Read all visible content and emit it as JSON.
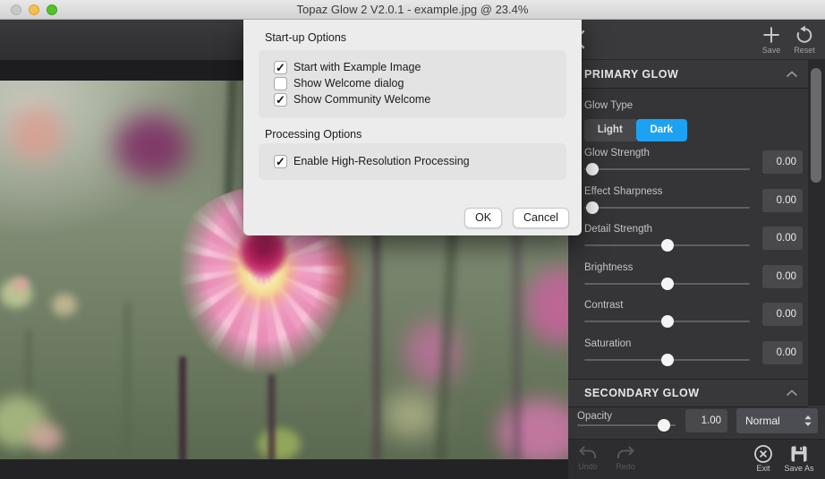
{
  "window": {
    "title": "Topaz Glow 2 V2.0.1 - example.jpg @ 23.4%"
  },
  "dialog": {
    "startup_section": {
      "title": "Start-up Options",
      "options": [
        {
          "label": "Start with Example Image",
          "checked": true
        },
        {
          "label": "Show Welcome dialog",
          "checked": false
        },
        {
          "label": "Show Community Welcome",
          "checked": true
        }
      ]
    },
    "processing_section": {
      "title": "Processing Options",
      "options": [
        {
          "label": "Enable High-Resolution Processing",
          "checked": true
        }
      ]
    },
    "buttons": {
      "ok": "OK",
      "cancel": "Cancel"
    }
  },
  "panel": {
    "toolbar": {
      "save": "Save",
      "reset": "Reset"
    },
    "primary_glow": {
      "title": "PRIMARY GLOW",
      "glow_type": {
        "label": "Glow Type",
        "options": [
          "Light",
          "Dark"
        ],
        "selected": "Dark"
      },
      "sliders": [
        {
          "label": "Glow Strength",
          "value": "0.00",
          "pos": 5
        },
        {
          "label": "Effect Sharpness",
          "value": "0.00",
          "pos": 5
        },
        {
          "label": "Detail Strength",
          "value": "0.00",
          "pos": 50
        },
        {
          "label": "Brightness",
          "value": "0.00",
          "pos": 50
        },
        {
          "label": "Contrast",
          "value": "0.00",
          "pos": 50
        },
        {
          "label": "Saturation",
          "value": "0.00",
          "pos": 50
        }
      ]
    },
    "secondary_glow": {
      "title": "SECONDARY GLOW",
      "opacity": {
        "label": "Opacity",
        "value": "1.00",
        "pos": 88
      },
      "blend_mode": "Normal"
    },
    "bottom_bar": {
      "undo": "Undo",
      "redo": "Redo",
      "exit": "Exit",
      "save_as": "Save As"
    }
  },
  "colors": {
    "accent_blue": "#1da1f2",
    "panel_bg": "#353537",
    "dialog_bg": "#ececec"
  }
}
